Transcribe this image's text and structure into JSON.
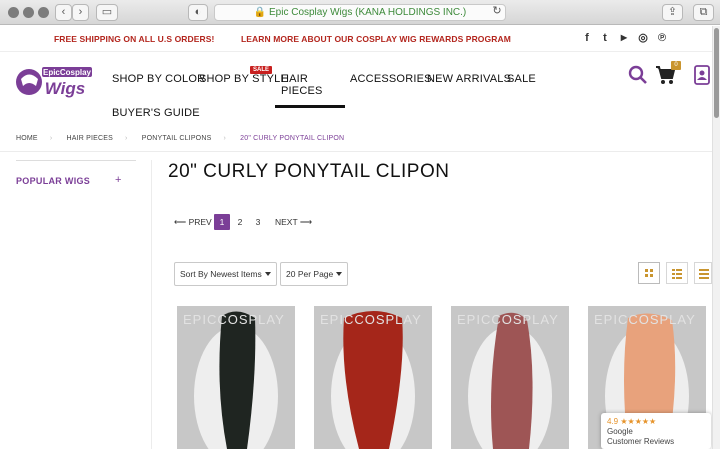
{
  "browser": {
    "address": "Epic Cosplay Wigs (KANA HOLDINGS INC.)"
  },
  "promo": {
    "left": "FREE SHIPPING ON ALL U.S ORDERS!",
    "center": "LEARN MORE ABOUT OUR COSPLAY WIG REWARDS PROGRAM"
  },
  "social": [
    "facebook-icon",
    "twitter-icon",
    "youtube-icon",
    "instagram-icon",
    "pinterest-icon"
  ],
  "logo": {
    "top": "EpicCosplay",
    "bottom": "Wigs"
  },
  "nav": {
    "items": [
      "SHOP BY COLOR",
      "SHOP BY STYLE",
      "HAIR PIECES",
      "ACCESSORIES",
      "NEW ARRIVALS",
      "SALE",
      "BUYER'S GUIDE"
    ],
    "sale_badge": "SALE",
    "cart_count": "0"
  },
  "breadcrumb": [
    "HOME",
    "HAIR PIECES",
    "PONYTAIL CLIPONS",
    "20\" CURLY PONYTAIL CLIPON"
  ],
  "sidebar": {
    "label": "POPULAR WIGS",
    "toggle": "+"
  },
  "page": {
    "title": "20\" CURLY PONYTAIL CLIPON"
  },
  "pager": {
    "prev": "PREV",
    "pages": [
      "1",
      "2",
      "3"
    ],
    "next": "NEXT"
  },
  "sort": {
    "value": "Sort By Newest Items"
  },
  "perpage": {
    "value": "20 Per Page"
  },
  "products": [
    {
      "watermark": "EPICCOSPLAY",
      "hair": "#1f2521",
      "side": "#ececec"
    },
    {
      "watermark": "EPICCOSPLAY",
      "hair": "#a5261a",
      "side": "#ececec"
    },
    {
      "watermark": "EPICCOSPLAY",
      "hair": "#9e5555",
      "side": "#ececec"
    },
    {
      "watermark": "EPICCOSPLAY",
      "hair": "#e8a27c",
      "side": "#ececec"
    }
  ],
  "reviews": {
    "rating": "4.9",
    "stars": "★★★★★",
    "source": "Google",
    "label": "Customer Reviews"
  },
  "colors": {
    "brand": "#7b3e97",
    "promo": "#b3261e"
  }
}
